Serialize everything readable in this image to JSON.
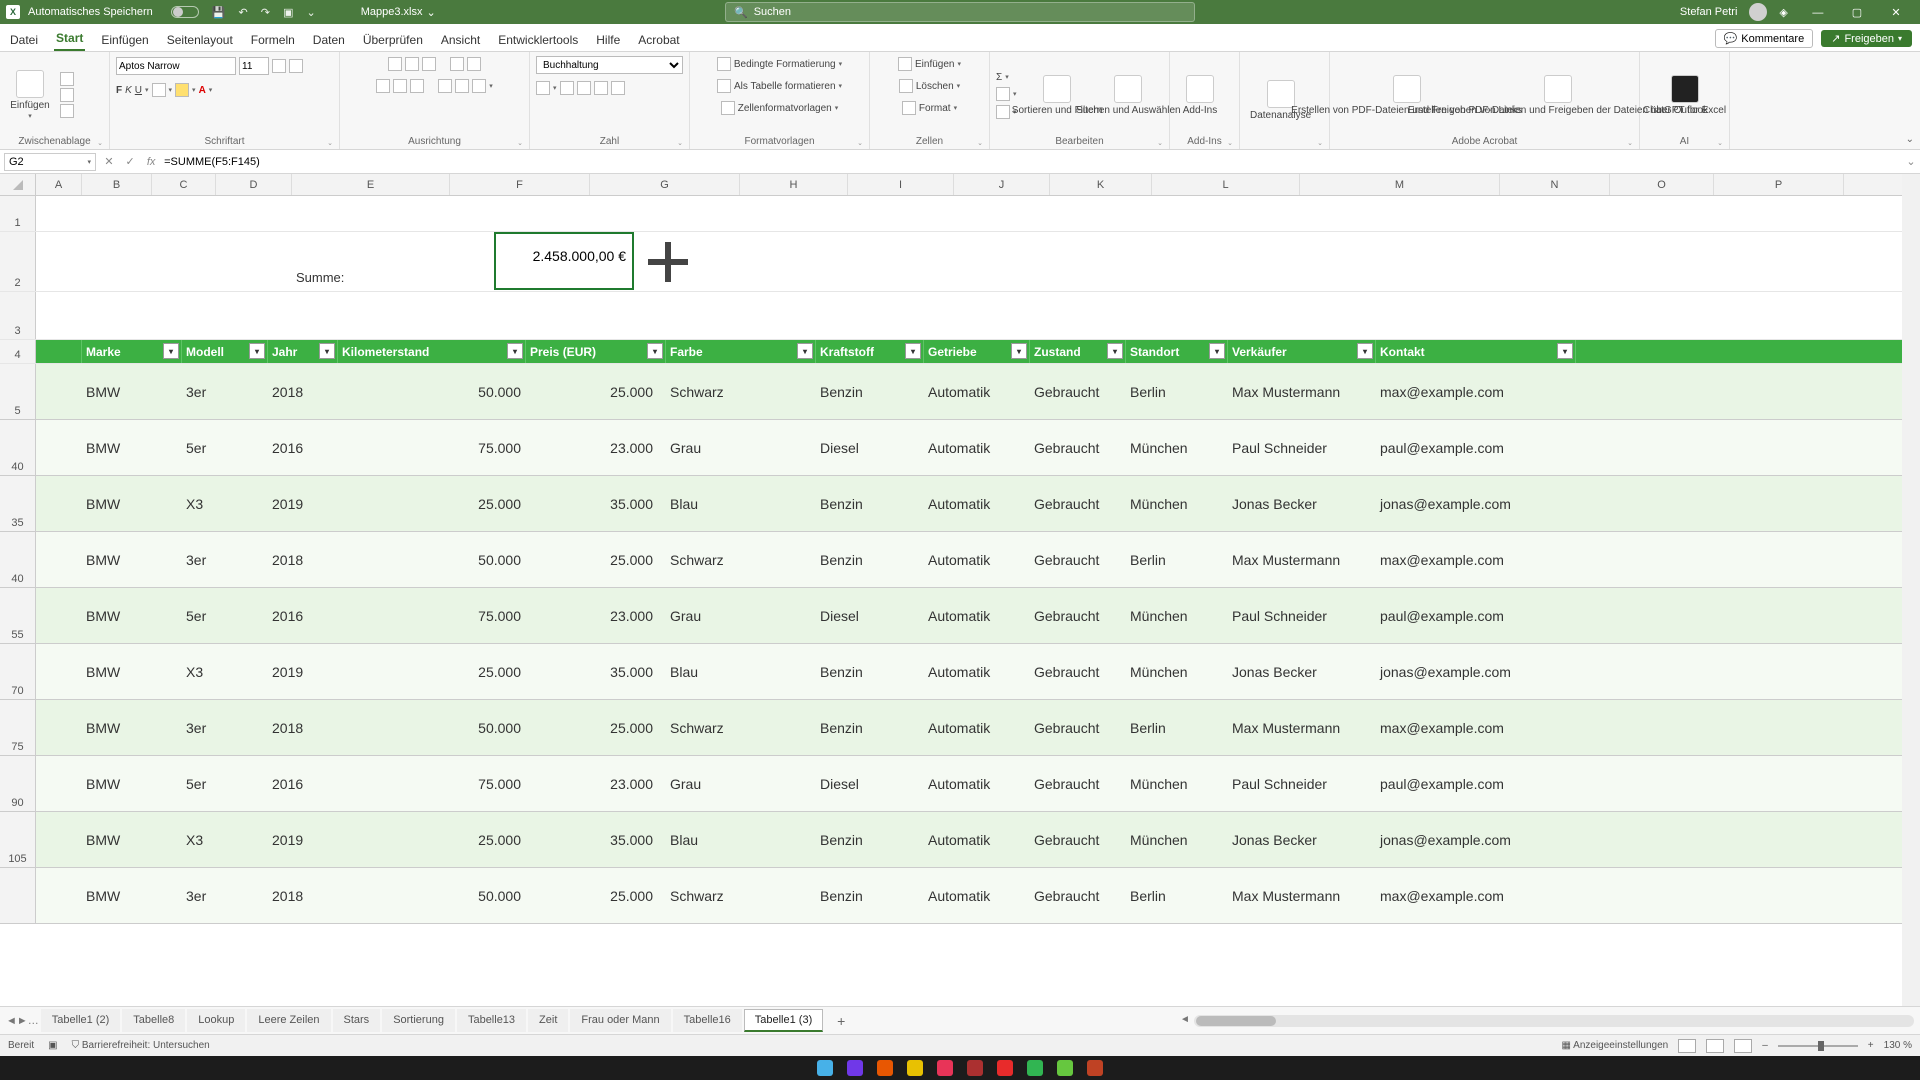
{
  "title": {
    "autosave_label": "Automatisches Speichern",
    "filename": "Mappe3.xlsx",
    "search_placeholder": "Suchen",
    "user": "Stefan Petri"
  },
  "tabs": {
    "items": [
      "Datei",
      "Start",
      "Einfügen",
      "Seitenlayout",
      "Formeln",
      "Daten",
      "Überprüfen",
      "Ansicht",
      "Entwicklertools",
      "Hilfe",
      "Acrobat"
    ],
    "active": 1,
    "comments": "Kommentare",
    "share": "Freigeben"
  },
  "ribbon": {
    "paste": "Einfügen",
    "clipboard": "Zwischenablage",
    "font_name": "Aptos Narrow",
    "font_size": "11",
    "font_group": "Schriftart",
    "alignment": "Ausrichtung",
    "number_format": "Buchhaltung",
    "number_group": "Zahl",
    "cond_fmt": "Bedingte Formatierung",
    "table_fmt": "Als Tabelle formatieren",
    "cell_fmt": "Zellenformatvorlagen",
    "styles_group": "Formatvorlagen",
    "insert": "Einfügen",
    "delete": "Löschen",
    "format": "Format",
    "cells_group": "Zellen",
    "sort": "Sortieren und Filtern",
    "find": "Suchen und Auswählen",
    "edit_group": "Bearbeiten",
    "addins": "Add-Ins",
    "addins_group": "Add-Ins",
    "dataanalysis": "Datenanalyse",
    "pdf1": "Erstellen von PDF-Dateien und Freigeben von Links",
    "pdf2": "Erstellen von PDF-Dateien und Freigeben der Dateien über Outlook",
    "acrobat_group": "Adobe Acrobat",
    "chatgpt": "ChatGPT for Excel",
    "ai_group": "AI"
  },
  "fx": {
    "name_box": "G2",
    "formula": "=SUMME(F5:F145)"
  },
  "columns": [
    "A",
    "B",
    "C",
    "D",
    "E",
    "F",
    "G",
    "H",
    "I",
    "J",
    "K",
    "L",
    "M",
    "N",
    "O",
    "P"
  ],
  "sum_label": "Summe:",
  "sum_value": "2.458.000,00 €",
  "table_headers": [
    "Marke",
    "Modell",
    "Jahr",
    "Kilometerstand",
    "Preis (EUR)",
    "Farbe",
    "Kraftstoff",
    "Getriebe",
    "Zustand",
    "Standort",
    "Verkäufer",
    "Kontakt"
  ],
  "row_numbers": [
    "1",
    "2",
    "3",
    "4",
    "5",
    "40",
    "35",
    "40",
    "55",
    "70",
    "75",
    "90",
    "105",
    ""
  ],
  "row_numbers2": [
    "1",
    "2",
    "3",
    "4",
    "5",
    "40",
    "35",
    "40",
    "55",
    "70",
    "75",
    "90",
    "105",
    ""
  ],
  "data_rows": [
    {
      "rn": "5",
      "marke": "BMW",
      "modell": "3er",
      "jahr": "2018",
      "km": "50.000",
      "preis": "25.000",
      "farbe": "Schwarz",
      "kraft": "Benzin",
      "getr": "Automatik",
      "zust": "Gebraucht",
      "ort": "Berlin",
      "verk": "Max Mustermann",
      "kontakt": "max@example.com"
    },
    {
      "rn": "40",
      "marke": "BMW",
      "modell": "5er",
      "jahr": "2016",
      "km": "75.000",
      "preis": "23.000",
      "farbe": "Grau",
      "kraft": "Diesel",
      "getr": "Automatik",
      "zust": "Gebraucht",
      "ort": "München",
      "verk": "Paul Schneider",
      "kontakt": "paul@example.com"
    },
    {
      "rn": "35",
      "marke": "BMW",
      "modell": "X3",
      "jahr": "2019",
      "km": "25.000",
      "preis": "35.000",
      "farbe": "Blau",
      "kraft": "Benzin",
      "getr": "Automatik",
      "zust": "Gebraucht",
      "ort": "München",
      "verk": "Jonas Becker",
      "kontakt": "jonas@example.com"
    },
    {
      "rn": "40",
      "marke": "BMW",
      "modell": "3er",
      "jahr": "2018",
      "km": "50.000",
      "preis": "25.000",
      "farbe": "Schwarz",
      "kraft": "Benzin",
      "getr": "Automatik",
      "zust": "Gebraucht",
      "ort": "Berlin",
      "verk": "Max Mustermann",
      "kontakt": "max@example.com"
    },
    {
      "rn": "55",
      "marke": "BMW",
      "modell": "5er",
      "jahr": "2016",
      "km": "75.000",
      "preis": "23.000",
      "farbe": "Grau",
      "kraft": "Diesel",
      "getr": "Automatik",
      "zust": "Gebraucht",
      "ort": "München",
      "verk": "Paul Schneider",
      "kontakt": "paul@example.com"
    },
    {
      "rn": "70",
      "marke": "BMW",
      "modell": "X3",
      "jahr": "2019",
      "km": "25.000",
      "preis": "35.000",
      "farbe": "Blau",
      "kraft": "Benzin",
      "getr": "Automatik",
      "zust": "Gebraucht",
      "ort": "München",
      "verk": "Jonas Becker",
      "kontakt": "jonas@example.com"
    },
    {
      "rn": "75",
      "marke": "BMW",
      "modell": "3er",
      "jahr": "2018",
      "km": "50.000",
      "preis": "25.000",
      "farbe": "Schwarz",
      "kraft": "Benzin",
      "getr": "Automatik",
      "zust": "Gebraucht",
      "ort": "Berlin",
      "verk": "Max Mustermann",
      "kontakt": "max@example.com"
    },
    {
      "rn": "90",
      "marke": "BMW",
      "modell": "5er",
      "jahr": "2016",
      "km": "75.000",
      "preis": "23.000",
      "farbe": "Grau",
      "kraft": "Diesel",
      "getr": "Automatik",
      "zust": "Gebraucht",
      "ort": "München",
      "verk": "Paul Schneider",
      "kontakt": "paul@example.com"
    },
    {
      "rn": "105",
      "marke": "BMW",
      "modell": "X3",
      "jahr": "2019",
      "km": "25.000",
      "preis": "35.000",
      "farbe": "Blau",
      "kraft": "Benzin",
      "getr": "Automatik",
      "zust": "Gebraucht",
      "ort": "München",
      "verk": "Jonas Becker",
      "kontakt": "jonas@example.com"
    },
    {
      "rn": "",
      "marke": "BMW",
      "modell": "3er",
      "jahr": "2018",
      "km": "50.000",
      "preis": "25.000",
      "farbe": "Schwarz",
      "kraft": "Benzin",
      "getr": "Automatik",
      "zust": "Gebraucht",
      "ort": "Berlin",
      "verk": "Max Mustermann",
      "kontakt": "max@example.com"
    }
  ],
  "sheets": {
    "items": [
      "Tabelle1 (2)",
      "Tabelle8",
      "Lookup",
      "Leere Zeilen",
      "Stars",
      "Sortierung",
      "Tabelle13",
      "Zeit",
      "Frau oder Mann",
      "Tabelle16",
      "Tabelle1 (3)"
    ],
    "active": 10
  },
  "status": {
    "ready": "Bereit",
    "acc": "Barrierefreiheit: Untersuchen",
    "display": "Anzeigeeinstellungen",
    "zoom": "130 %"
  }
}
